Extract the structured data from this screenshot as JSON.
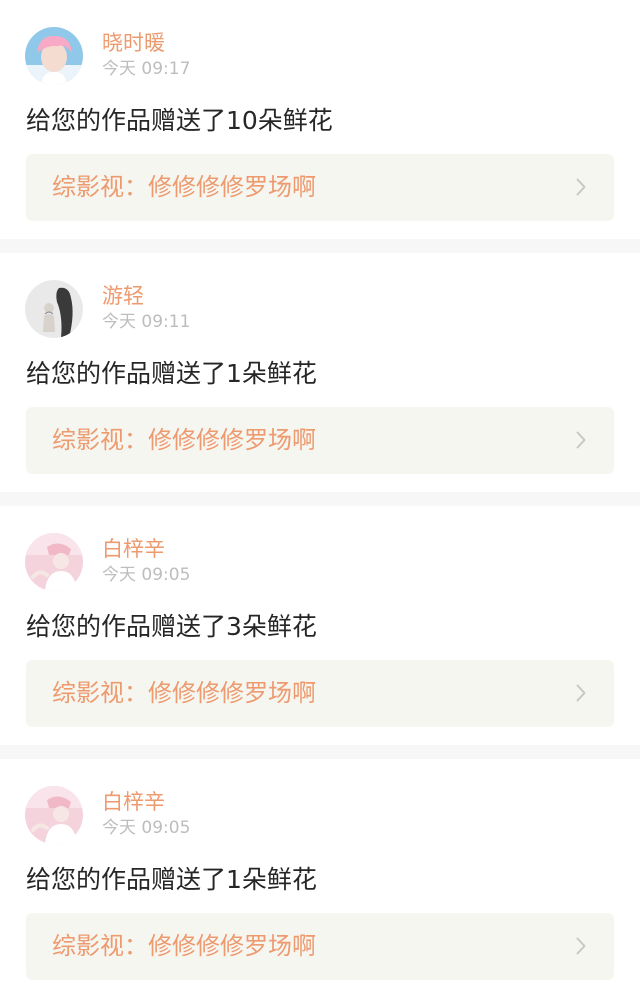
{
  "notifications": [
    {
      "username": "晓时暖",
      "time": "今天 09:17",
      "message": "给您的作品赠送了10朵鲜花",
      "work": "综影视：修修修修罗场啊",
      "avatar_icon": "avatar-pink-hair-boy",
      "avatar_colors": {
        "bg": "#8fc8e8",
        "hair": "#f7a9c6",
        "skin": "#f5dcd0"
      }
    },
    {
      "username": "游轻",
      "time": "今天 09:11",
      "message": "给您的作品赠送了1朵鲜花",
      "work": "综影视：修修修修罗场啊",
      "avatar_icon": "avatar-dark-figure",
      "avatar_colors": {
        "bg": "#e9e9e9",
        "hair": "#3a3a3a",
        "skin": "#d8d2cc"
      }
    },
    {
      "username": "白梓辛",
      "time": "今天 09:05",
      "message": "给您的作品赠送了3朵鲜花",
      "work": "综影视：修修修修罗场啊",
      "avatar_icon": "avatar-pink-cap-girl",
      "avatar_colors": {
        "bg": "#f4d3dd",
        "hair": "#f1b8c8",
        "skin": "#f7e7e4"
      }
    },
    {
      "username": "白梓辛",
      "time": "今天 09:05",
      "message": "给您的作品赠送了1朵鲜花",
      "work": "综影视：修修修修罗场啊",
      "avatar_icon": "avatar-pink-cap-girl",
      "avatar_colors": {
        "bg": "#f4d3dd",
        "hair": "#f1b8c8",
        "skin": "#f7e7e4"
      }
    }
  ],
  "colors": {
    "accent": "#ee9a6f",
    "timestamp": "#bdbdbd",
    "message": "#262626",
    "link_bg": "#f6f6f1",
    "divider": "#f7f7f7",
    "top_indicator": "#f06ea0"
  },
  "icons": {
    "chevron": "chevron-right-icon"
  }
}
